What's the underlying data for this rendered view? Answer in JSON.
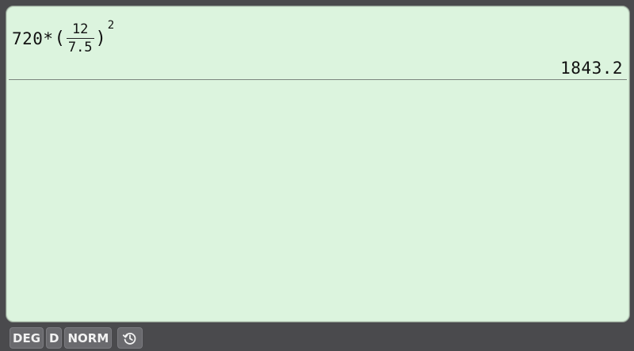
{
  "expression": {
    "multiplier": "720*",
    "open_paren": "(",
    "numerator": "12",
    "denominator": "7.5",
    "close_paren": ")",
    "exponent": "2"
  },
  "result": "1843.2",
  "status_bar": {
    "angle_mode": "DEG",
    "d_flag": "D",
    "display_mode": "NORM",
    "history_icon": "history-icon"
  },
  "colors": {
    "screen_background": "#dcf4de",
    "bezel": "#4a4a4d",
    "chip_background": "#6a6a6e",
    "text": "#111111"
  }
}
